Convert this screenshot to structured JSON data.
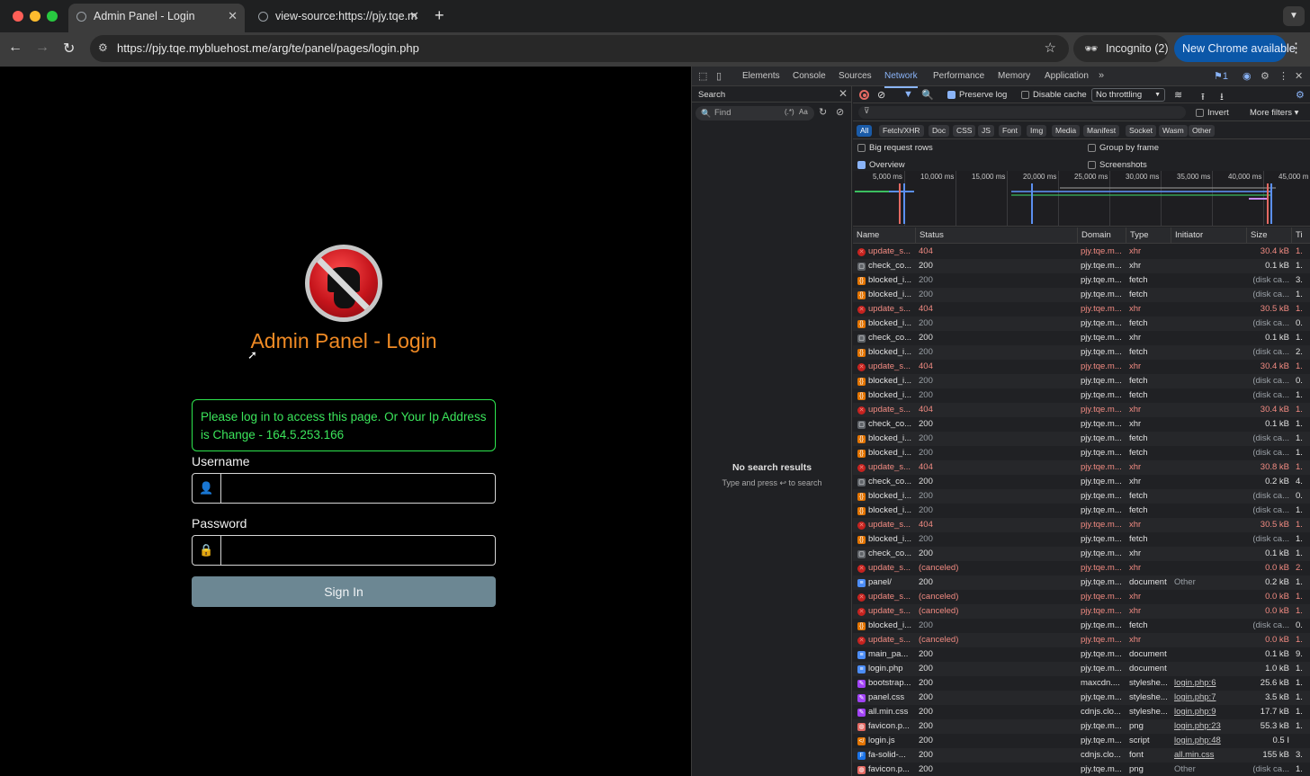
{
  "browser": {
    "tabs": [
      {
        "title": "Admin Panel - Login",
        "active": true
      },
      {
        "title": "view-source:https://pjy.tqe.m",
        "active": false
      }
    ],
    "url": "https://pjy.tqe.mybluehost.me/arg/te/panel/pages/login.php",
    "incognito_label": "Incognito (2)",
    "update_label": "New Chrome available"
  },
  "page": {
    "title": "Admin Panel - Login",
    "alert_text": "Please log in to access this page. Or Your Ip Address is Change - 164.5.253.166",
    "username_label": "Username",
    "username_value": "",
    "password_label": "Password",
    "password_value": "",
    "signin_label": "Sign In",
    "accent_color": "#f08a24",
    "alert_color": "#3be55b"
  },
  "devtools": {
    "tabs": [
      "Elements",
      "Console",
      "Sources",
      "Network",
      "Performance",
      "Memory",
      "Application"
    ],
    "active_tab": "Network",
    "issues_count": "1",
    "search": {
      "title": "Search",
      "placeholder": "Find",
      "regex_label": "(.*)",
      "case_label": "Aa",
      "empty_title": "No search results",
      "empty_hint": "Type and press ↩ to search"
    },
    "network": {
      "preserve_log": "Preserve log",
      "disable_cache": "Disable cache",
      "throttling": "No throttling",
      "invert": "Invert",
      "more_filters": "More filters",
      "type_filters": [
        "All",
        "Fetch/XHR",
        "Doc",
        "CSS",
        "JS",
        "Font",
        "Img",
        "Media",
        "Manifest",
        "Socket",
        "Wasm",
        "Other"
      ],
      "big_request_rows": "Big request rows",
      "group_by_frame": "Group by frame",
      "overview": "Overview",
      "screenshots": "Screenshots",
      "timeline_ticks": [
        "5,000 ms",
        "10,000 ms",
        "15,000 ms",
        "20,000 ms",
        "25,000 ms",
        "30,000 ms",
        "35,000 ms",
        "40,000 ms",
        "45,000 m"
      ],
      "columns": [
        "Name",
        "Status",
        "Domain",
        "Type",
        "Initiator",
        "Size",
        "Ti"
      ],
      "rows": [
        {
          "name": "update_s...",
          "status": "404",
          "domain": "pjy.tqe.m...",
          "type": "xhr",
          "initiator": "",
          "size": "30.4 kB",
          "time": "1.",
          "kind": "err"
        },
        {
          "name": "check_co...",
          "status": "200",
          "domain": "pjy.tqe.m...",
          "type": "xhr",
          "initiator": "",
          "size": "0.1 kB",
          "time": "1.",
          "kind": "doc"
        },
        {
          "name": "blocked_i...",
          "status": "200",
          "domain": "pjy.tqe.m...",
          "type": "fetch",
          "initiator": "",
          "size": "(disk ca...",
          "time": "3.",
          "kind": "fetch"
        },
        {
          "name": "blocked_i...",
          "status": "200",
          "domain": "pjy.tqe.m...",
          "type": "fetch",
          "initiator": "",
          "size": "(disk ca...",
          "time": "1.",
          "kind": "fetch"
        },
        {
          "name": "update_s...",
          "status": "404",
          "domain": "pjy.tqe.m...",
          "type": "xhr",
          "initiator": "",
          "size": "30.5 kB",
          "time": "1.",
          "kind": "err"
        },
        {
          "name": "blocked_i...",
          "status": "200",
          "domain": "pjy.tqe.m...",
          "type": "fetch",
          "initiator": "",
          "size": "(disk ca...",
          "time": "0.",
          "kind": "fetch"
        },
        {
          "name": "check_co...",
          "status": "200",
          "domain": "pjy.tqe.m...",
          "type": "xhr",
          "initiator": "",
          "size": "0.1 kB",
          "time": "1.",
          "kind": "doc"
        },
        {
          "name": "blocked_i...",
          "status": "200",
          "domain": "pjy.tqe.m...",
          "type": "fetch",
          "initiator": "",
          "size": "(disk ca...",
          "time": "2.",
          "kind": "fetch"
        },
        {
          "name": "update_s...",
          "status": "404",
          "domain": "pjy.tqe.m...",
          "type": "xhr",
          "initiator": "",
          "size": "30.4 kB",
          "time": "1.",
          "kind": "err"
        },
        {
          "name": "blocked_i...",
          "status": "200",
          "domain": "pjy.tqe.m...",
          "type": "fetch",
          "initiator": "",
          "size": "(disk ca...",
          "time": "0.",
          "kind": "fetch"
        },
        {
          "name": "blocked_i...",
          "status": "200",
          "domain": "pjy.tqe.m...",
          "type": "fetch",
          "initiator": "",
          "size": "(disk ca...",
          "time": "1.",
          "kind": "fetch"
        },
        {
          "name": "update_s...",
          "status": "404",
          "domain": "pjy.tqe.m...",
          "type": "xhr",
          "initiator": "",
          "size": "30.4 kB",
          "time": "1.",
          "kind": "err"
        },
        {
          "name": "check_co...",
          "status": "200",
          "domain": "pjy.tqe.m...",
          "type": "xhr",
          "initiator": "",
          "size": "0.1 kB",
          "time": "1.",
          "kind": "doc"
        },
        {
          "name": "blocked_i...",
          "status": "200",
          "domain": "pjy.tqe.m...",
          "type": "fetch",
          "initiator": "",
          "size": "(disk ca...",
          "time": "1.",
          "kind": "fetch"
        },
        {
          "name": "blocked_i...",
          "status": "200",
          "domain": "pjy.tqe.m...",
          "type": "fetch",
          "initiator": "",
          "size": "(disk ca...",
          "time": "1.",
          "kind": "fetch"
        },
        {
          "name": "update_s...",
          "status": "404",
          "domain": "pjy.tqe.m...",
          "type": "xhr",
          "initiator": "",
          "size": "30.8 kB",
          "time": "1.",
          "kind": "err"
        },
        {
          "name": "check_co...",
          "status": "200",
          "domain": "pjy.tqe.m...",
          "type": "xhr",
          "initiator": "",
          "size": "0.2 kB",
          "time": "4.",
          "kind": "doc"
        },
        {
          "name": "blocked_i...",
          "status": "200",
          "domain": "pjy.tqe.m...",
          "type": "fetch",
          "initiator": "",
          "size": "(disk ca...",
          "time": "0.",
          "kind": "fetch"
        },
        {
          "name": "blocked_i...",
          "status": "200",
          "domain": "pjy.tqe.m...",
          "type": "fetch",
          "initiator": "",
          "size": "(disk ca...",
          "time": "1.",
          "kind": "fetch"
        },
        {
          "name": "update_s...",
          "status": "404",
          "domain": "pjy.tqe.m...",
          "type": "xhr",
          "initiator": "",
          "size": "30.5 kB",
          "time": "1.",
          "kind": "err"
        },
        {
          "name": "blocked_i...",
          "status": "200",
          "domain": "pjy.tqe.m...",
          "type": "fetch",
          "initiator": "",
          "size": "(disk ca...",
          "time": "1.",
          "kind": "fetch"
        },
        {
          "name": "check_co...",
          "status": "200",
          "domain": "pjy.tqe.m...",
          "type": "xhr",
          "initiator": "",
          "size": "0.1 kB",
          "time": "1.",
          "kind": "doc"
        },
        {
          "name": "update_s...",
          "status": "(canceled)",
          "domain": "pjy.tqe.m...",
          "type": "xhr",
          "initiator": "",
          "size": "0.0 kB",
          "time": "2.",
          "kind": "err"
        },
        {
          "name": "panel/",
          "status": "200",
          "domain": "pjy.tqe.m...",
          "type": "document",
          "initiator": "Other",
          "size": "0.2 kB",
          "time": "1.",
          "kind": "html"
        },
        {
          "name": "update_s...",
          "status": "(canceled)",
          "domain": "pjy.tqe.m...",
          "type": "xhr",
          "initiator": "",
          "size": "0.0 kB",
          "time": "1.",
          "kind": "err"
        },
        {
          "name": "update_s...",
          "status": "(canceled)",
          "domain": "pjy.tqe.m...",
          "type": "xhr",
          "initiator": "",
          "size": "0.0 kB",
          "time": "1.",
          "kind": "err"
        },
        {
          "name": "blocked_i...",
          "status": "200",
          "domain": "pjy.tqe.m...",
          "type": "fetch",
          "initiator": "",
          "size": "(disk ca...",
          "time": "0.",
          "kind": "fetch"
        },
        {
          "name": "update_s...",
          "status": "(canceled)",
          "domain": "pjy.tqe.m...",
          "type": "xhr",
          "initiator": "",
          "size": "0.0 kB",
          "time": "1.",
          "kind": "err"
        },
        {
          "name": "main_pa...",
          "status": "200",
          "domain": "pjy.tqe.m...",
          "type": "document",
          "initiator": "",
          "size": "0.1 kB",
          "time": "9.",
          "kind": "html"
        },
        {
          "name": "login.php",
          "status": "200",
          "domain": "pjy.tqe.m...",
          "type": "document",
          "initiator": "",
          "size": "1.0 kB",
          "time": "1.",
          "kind": "html"
        },
        {
          "name": "bootstrap...",
          "status": "200",
          "domain": "maxcdn....",
          "type": "styleshe...",
          "initiator": "login.php:6",
          "size": "25.6 kB",
          "time": "1.",
          "kind": "css"
        },
        {
          "name": "panel.css",
          "status": "200",
          "domain": "pjy.tqe.m...",
          "type": "styleshe...",
          "initiator": "login.php:7",
          "size": "3.5 kB",
          "time": "1.",
          "kind": "css"
        },
        {
          "name": "all.min.css",
          "status": "200",
          "domain": "cdnjs.clo...",
          "type": "styleshe...",
          "initiator": "login.php:9",
          "size": "17.7 kB",
          "time": "1.",
          "kind": "css"
        },
        {
          "name": "favicon.p...",
          "status": "200",
          "domain": "pjy.tqe.m...",
          "type": "png",
          "initiator": "login.php:23",
          "size": "55.3 kB",
          "time": "1.",
          "kind": "img"
        },
        {
          "name": "login.js",
          "status": "200",
          "domain": "pjy.tqe.m...",
          "type": "script",
          "initiator": "login.php:48",
          "size": "0.5 I",
          "time": "",
          "kind": "js"
        },
        {
          "name": "fa-solid-...",
          "status": "200",
          "domain": "cdnjs.clo...",
          "type": "font",
          "initiator": "all.min.css",
          "size": "155 kB",
          "time": "3.",
          "kind": "font"
        },
        {
          "name": "favicon.p...",
          "status": "200",
          "domain": "pjy.tqe.m...",
          "type": "png",
          "initiator": "Other",
          "size": "(disk ca...",
          "time": "1.",
          "kind": "img"
        }
      ]
    }
  }
}
